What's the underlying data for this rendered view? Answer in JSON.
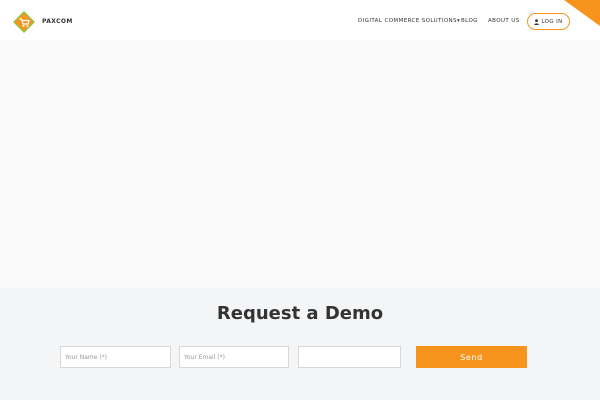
{
  "header": {
    "brand": "PAXCOM",
    "logo_icon": "cart-diamond-logo-icon",
    "nav": [
      {
        "label": "DIGITAL COMMERCE SOLUTIONS▾"
      },
      {
        "label": "BLOG"
      },
      {
        "label": "ABOUT US"
      }
    ],
    "login": {
      "label": "LOG IN",
      "icon": "user-icon"
    }
  },
  "demo": {
    "title": "Request a Demo",
    "name_placeholder": "Your Name (*)",
    "email_placeholder": "Your Email (*)",
    "extra_placeholder": "",
    "send_label": "Send"
  },
  "colors": {
    "accent": "#f7941d",
    "logo_green": "#8dc63f",
    "text": "#333333",
    "section_bg": "#f4f5f7"
  }
}
